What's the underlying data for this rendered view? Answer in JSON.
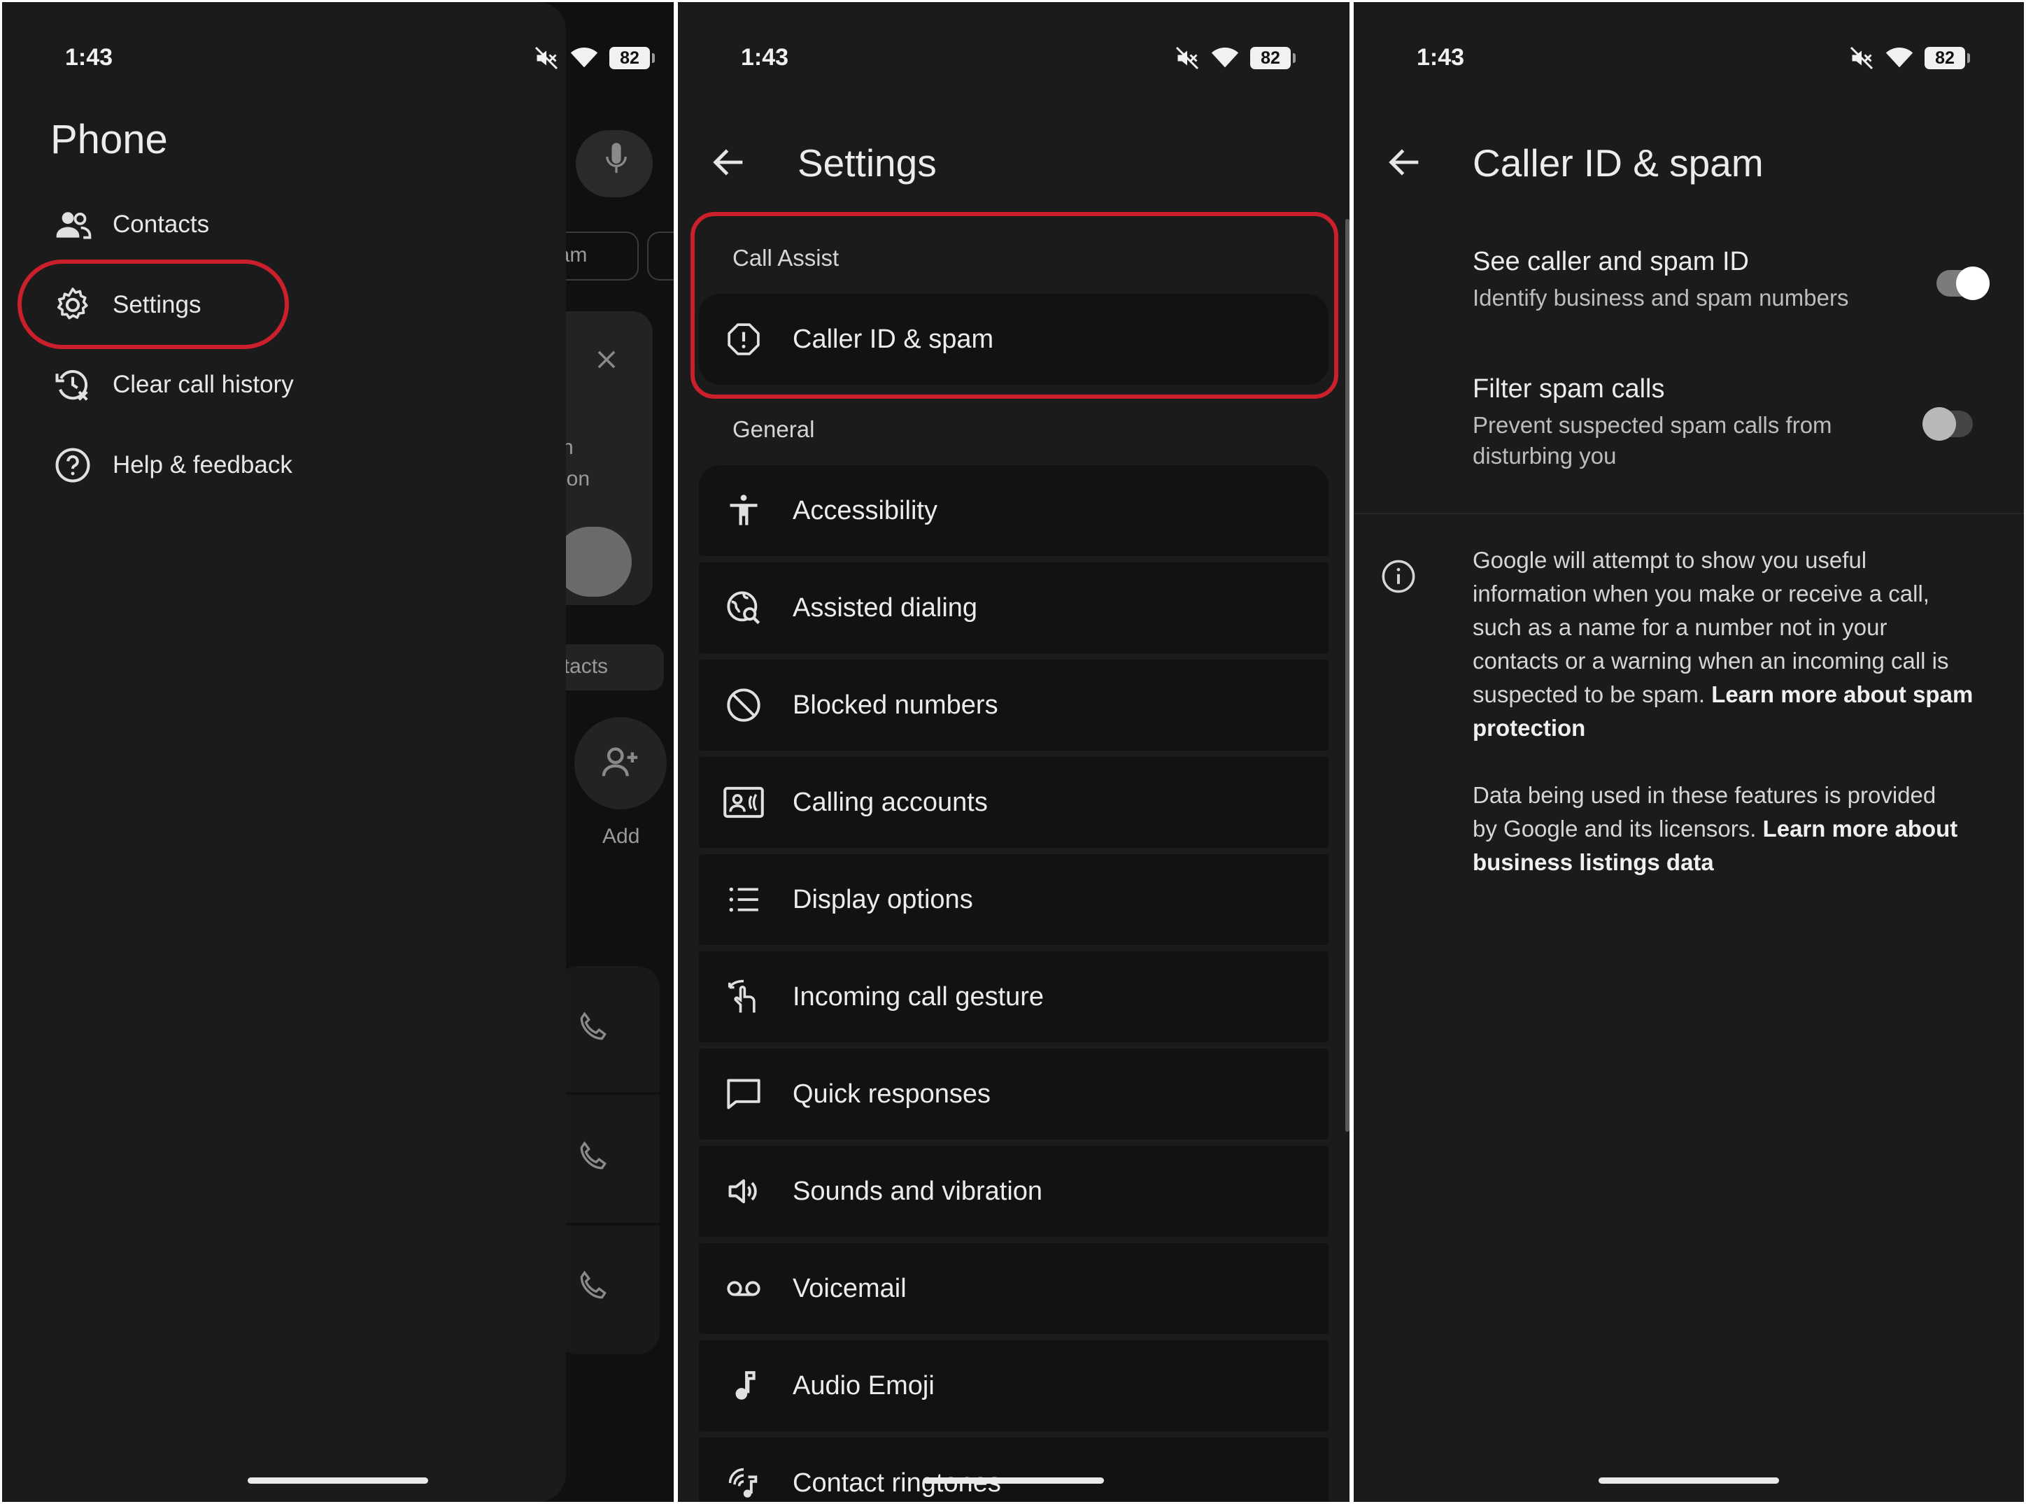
{
  "status": {
    "time": "1:43",
    "battery": "82"
  },
  "panel1": {
    "drawer_title": "Phone",
    "menu": [
      {
        "label": "Contacts",
        "icon": "contacts-icon"
      },
      {
        "label": "Settings",
        "icon": "gear-icon"
      },
      {
        "label": "Clear call history",
        "icon": "clear-history-icon"
      },
      {
        "label": "Help & feedback",
        "icon": "help-icon"
      }
    ],
    "background": {
      "chip_label": "pam",
      "card_text_1": "h",
      "card_text_2": "ion",
      "chip_contacts": "ntacts",
      "add_label": "Add"
    }
  },
  "panel2": {
    "title": "Settings",
    "section_call_assist": "Call Assist",
    "section_general": "General",
    "items": [
      {
        "label": "Caller ID & spam",
        "icon": "alert-circle-icon"
      },
      {
        "label": "Accessibility",
        "icon": "accessibility-icon"
      },
      {
        "label": "Assisted dialing",
        "icon": "assisted-dialing-icon"
      },
      {
        "label": "Blocked numbers",
        "icon": "block-icon"
      },
      {
        "label": "Calling accounts",
        "icon": "calling-accounts-icon"
      },
      {
        "label": "Display options",
        "icon": "list-icon"
      },
      {
        "label": "Incoming call gesture",
        "icon": "gesture-icon"
      },
      {
        "label": "Quick responses",
        "icon": "message-icon"
      },
      {
        "label": "Sounds and vibration",
        "icon": "volume-icon"
      },
      {
        "label": "Voicemail",
        "icon": "voicemail-icon"
      },
      {
        "label": "Audio Emoji",
        "icon": "music-note-icon"
      },
      {
        "label": "Contact ringtones",
        "icon": "ringtone-icon"
      }
    ]
  },
  "panel3": {
    "title": "Caller ID & spam",
    "see_caller": {
      "title": "See caller and spam ID",
      "subtitle": "Identify business and spam numbers",
      "enabled": true
    },
    "filter_spam": {
      "title": "Filter spam calls",
      "subtitle_line1": "Prevent suspected spam calls from",
      "subtitle_line2": "disturbing you",
      "enabled": false
    },
    "info1_lines": [
      "Google will attempt to show you useful",
      "information when you make or receive a call,",
      "such as a name for a number not in your",
      "contacts or a warning when an incoming call is",
      "suspected to be spam."
    ],
    "info1_link_1": "Learn more about spam",
    "info1_link_2": "protection",
    "info2_line1": "Data being used in these features is provided",
    "info2_line2": "by Google and its licensors.",
    "info2_link_1": "Learn more about",
    "info2_link_2": "business listings data"
  }
}
